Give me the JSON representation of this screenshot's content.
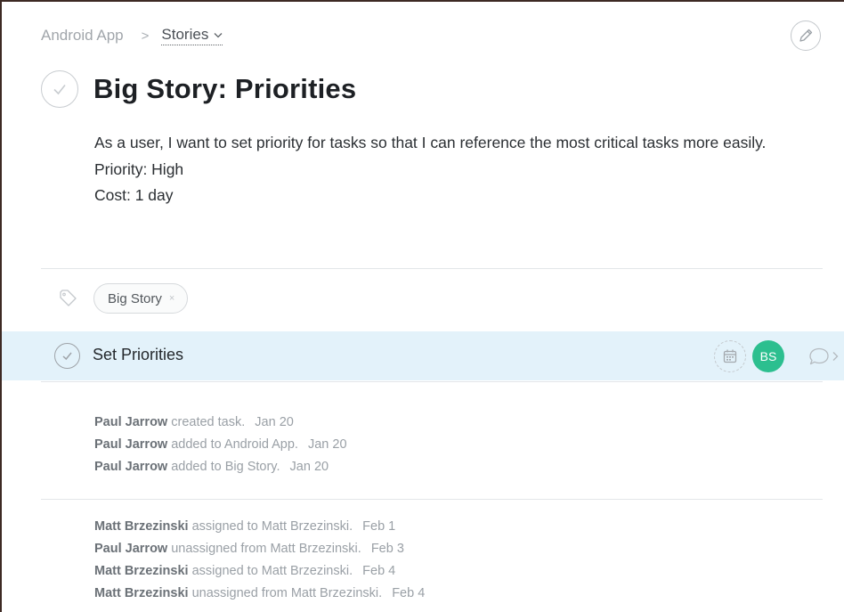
{
  "breadcrumb": {
    "project": "Android App",
    "separator": ">",
    "current": "Stories"
  },
  "task": {
    "title": "Big Story: Priorities",
    "description": [
      "As a user, I want to set priority for tasks so that I can reference the most critical tasks more easily.",
      "Priority: High",
      "Cost: 1 day"
    ]
  },
  "tags": [
    {
      "label": "Big Story",
      "remove": "×"
    }
  ],
  "subtask": {
    "name": "Set Priorities",
    "assignee_initials": "BS"
  },
  "colors": {
    "accent_highlight": "#e3f2fa",
    "assignee_avatar": "#2cbf8f"
  },
  "icons": [
    "pencil-icon",
    "checkmark-icon",
    "tag-icon",
    "calendar-icon",
    "comment-icon",
    "chevron-right-icon",
    "chevron-down-icon"
  ],
  "activity_groups": [
    [
      {
        "actor": "Paul Jarrow",
        "action": "created task.",
        "date": "Jan 20"
      },
      {
        "actor": "Paul Jarrow",
        "action": "added to Android App.",
        "date": "Jan 20"
      },
      {
        "actor": "Paul Jarrow",
        "action": "added to Big Story.",
        "date": "Jan 20"
      }
    ],
    [
      {
        "actor": "Matt Brzezinski",
        "action": "assigned to Matt Brzezinski.",
        "date": "Feb 1"
      },
      {
        "actor": "Paul Jarrow",
        "action": "unassigned from Matt Brzezinski.",
        "date": "Feb 3"
      },
      {
        "actor": "Matt Brzezinski",
        "action": "assigned to Matt Brzezinski.",
        "date": "Feb 4"
      },
      {
        "actor": "Matt Brzezinski",
        "action": "unassigned from Matt Brzezinski.",
        "date": "Feb 4"
      }
    ]
  ]
}
